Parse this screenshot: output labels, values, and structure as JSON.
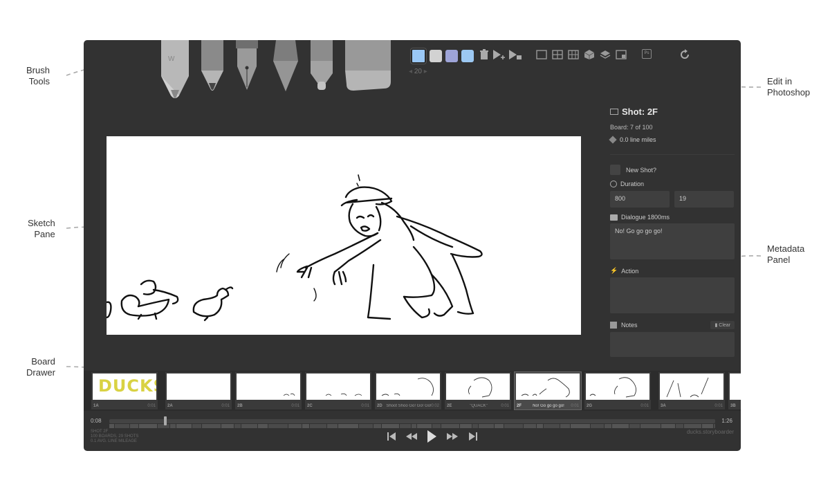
{
  "callouts": {
    "brush_tools": [
      "Brush",
      "Tools"
    ],
    "sketch_pane": [
      "Sketch",
      "Pane"
    ],
    "board_drawer": [
      "Board",
      "Drawer"
    ],
    "edit_in_photoshop": [
      "Edit in",
      "Photoshop"
    ],
    "metadata_panel": [
      "Metadata",
      "Panel"
    ]
  },
  "toolbar": {
    "colors": [
      "#9ac8f6",
      "#d2d2d2",
      "#9ea4d8",
      "#9cc8f2"
    ],
    "brush_size": "20",
    "photoshop_label": "Ps"
  },
  "metadata": {
    "shot_label": "Shot: 2F",
    "board_position": "Board: 7 of 100",
    "line_miles": "0.0 line miles",
    "new_shot_label": "New Shot?",
    "duration_label": "Duration",
    "duration_ms": "800",
    "duration_frames": "19",
    "dialogue_label": "Dialogue 1800ms",
    "dialogue_text": "No! Go go go go!",
    "action_label": "Action",
    "action_text": "",
    "notes_label": "Notes",
    "clear_label": "Clear"
  },
  "boards": [
    {
      "num": "1A",
      "dialogue": "",
      "duration": "0:01",
      "title_text": "DUCKS"
    },
    {
      "num": "2A",
      "dialogue": "",
      "duration": "0:01"
    },
    {
      "num": "2B",
      "dialogue": "",
      "duration": "0:01"
    },
    {
      "num": "2C",
      "dialogue": "",
      "duration": "0:01"
    },
    {
      "num": "2D",
      "dialogue": "Shoot Shoo Go! Go! Go!",
      "duration": "0:02"
    },
    {
      "num": "2E",
      "dialogue": "\"QUACK\"",
      "duration": "0:01"
    },
    {
      "num": "2F",
      "dialogue": "No! Go go go go!",
      "duration": "0:01"
    },
    {
      "num": "2G",
      "dialogue": "",
      "duration": "0:01"
    },
    {
      "num": "3A",
      "dialogue": "",
      "duration": "0:01"
    },
    {
      "num": "3B",
      "dialogue": "",
      "duration": ""
    }
  ],
  "timeline": {
    "current_time": "0:08",
    "total_time": "1:26",
    "playhead_fraction": 0.09
  },
  "project_stats": [
    "SHOT 2F",
    "100 BOARDS, 29 SHOTS",
    "0.1 AVG. LINE MILEAGE"
  ],
  "project_name": "ducks.storyboarder"
}
